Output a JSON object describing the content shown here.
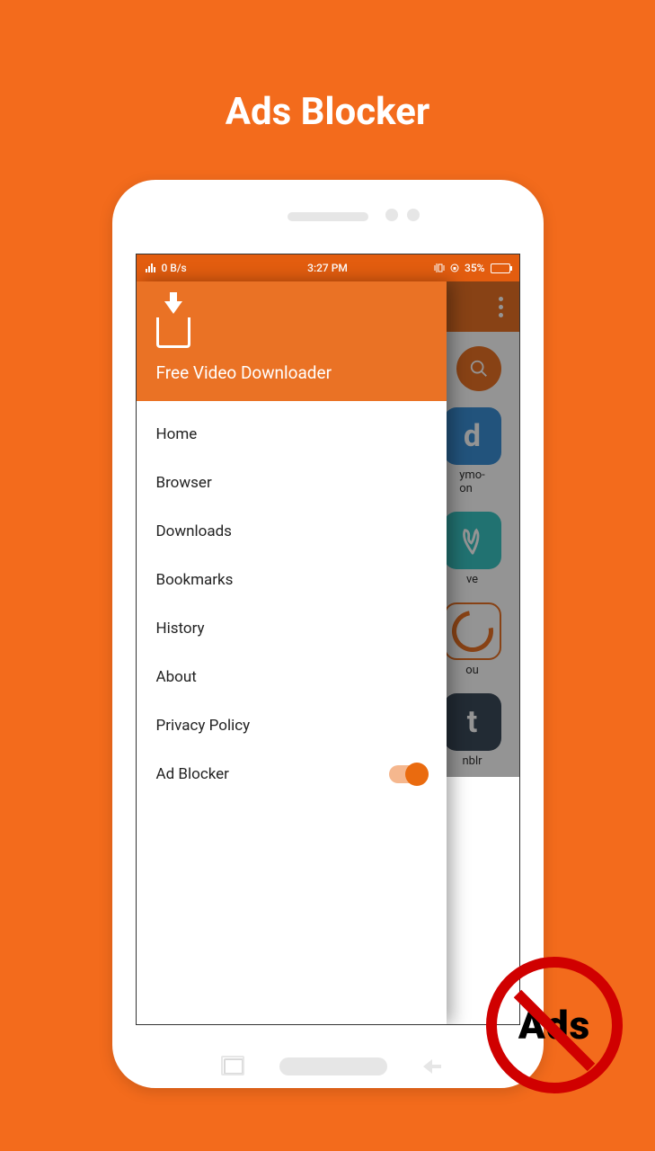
{
  "promo": {
    "title": "Ads Blocker"
  },
  "statusbar": {
    "signal": "0 B/s",
    "time": "3:27 PM",
    "battery": "35%"
  },
  "drawer": {
    "app_name": "Free Video Downloader",
    "items": [
      {
        "label": "Home"
      },
      {
        "label": "Browser"
      },
      {
        "label": "Downloads"
      },
      {
        "label": "Bookmarks"
      },
      {
        "label": "History"
      },
      {
        "label": "About"
      },
      {
        "label": "Privacy Policy"
      },
      {
        "label": "Ad Blocker",
        "toggle": true,
        "on": true
      }
    ]
  },
  "background": {
    "tiles": [
      {
        "label_line1": "ymo-",
        "label_line2": "on"
      },
      {
        "label_line1": "ve"
      },
      {
        "label_line1": "ou"
      },
      {
        "label_line1": "nblr"
      }
    ]
  },
  "badge": {
    "text": "Ads"
  }
}
